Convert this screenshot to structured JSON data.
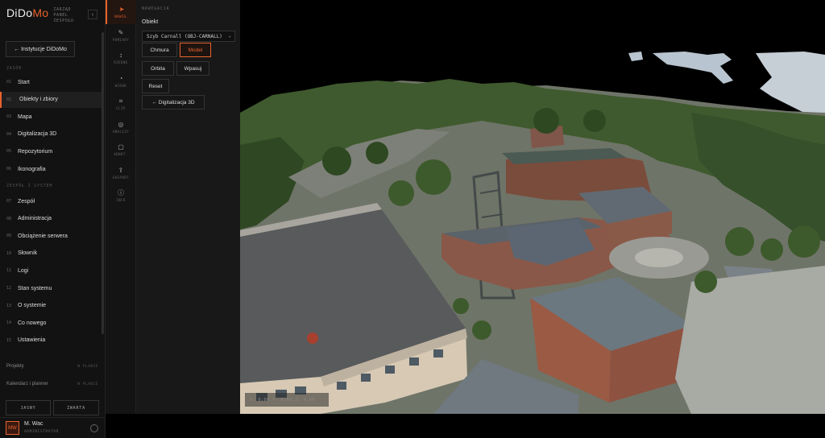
{
  "brand": {
    "logo_main": "DiDo",
    "logo_accent": "Mo",
    "subtitle_lines": [
      "ZARZĄD",
      "PANEL",
      "ZESPOŁU"
    ],
    "collapse_icon": "‹",
    "accent": "#e8622d"
  },
  "sidebar": {
    "institution_button": "← Instytucje DiDoMo",
    "section_zasob": "ZASÓB",
    "section_zespol": "ZESPÓŁ I SYSTEM",
    "items": [
      {
        "num": "01",
        "label": "Start"
      },
      {
        "num": "02",
        "label": "Obiekty i zbiory"
      },
      {
        "num": "03",
        "label": "Mapa"
      },
      {
        "num": "04",
        "label": "Digitalizacja 3D"
      },
      {
        "num": "05",
        "label": "Repozytorium"
      },
      {
        "num": "06",
        "label": "Ikonografia"
      }
    ],
    "items_system": [
      {
        "num": "07",
        "label": "Zespół"
      },
      {
        "num": "08",
        "label": "Administracja"
      },
      {
        "num": "09",
        "label": "Obciążenie serwera"
      },
      {
        "num": "10",
        "label": "Słownik"
      },
      {
        "num": "11",
        "label": "Logi"
      },
      {
        "num": "12",
        "label": "Stan systemu"
      },
      {
        "num": "13",
        "label": "O systemie"
      },
      {
        "num": "14",
        "label": "Co nowego"
      },
      {
        "num": "15",
        "label": "Ustawienia"
      }
    ],
    "sub_items": [
      {
        "label": "Projekty",
        "tag": "W PLANIE"
      },
      {
        "label": "Kalendarz i planner",
        "tag": "W PLANIE"
      }
    ],
    "footer_buttons": {
      "light": "JASNY",
      "font": "ZWARTA"
    },
    "user": {
      "initials": "MW",
      "name": "M. Wac",
      "role": "ADMINISTRATOR"
    }
  },
  "tools": [
    {
      "icon": "➤",
      "label": "NAWIG."
    },
    {
      "icon": "✎",
      "label": "POMIARY"
    },
    {
      "icon": "↕",
      "label": "RZEDNE"
    },
    {
      "icon": "◔",
      "label": "WIDOK"
    },
    {
      "icon": "⌗",
      "label": "CLIP"
    },
    {
      "icon": "◎",
      "label": "ANALIZY"
    },
    {
      "icon": "▢",
      "label": "ADNOT."
    },
    {
      "icon": "⇪",
      "label": "EKSPORT"
    },
    {
      "icon": "ⓘ",
      "label": "INFO"
    }
  ],
  "panel": {
    "heading": "NAWIGACJA",
    "object_label": "Obiekt",
    "object_value": "Szyb Carnall (OBJ-CARNALL)",
    "buttons": {
      "cloud": "Chmura",
      "model": "Model",
      "orbit": "Orbita",
      "fit": "Wpasuj",
      "reset": "Reset",
      "back": "← Digitalizacja 3D"
    }
  },
  "viewport": {
    "coord_readout": "X: 0.00  Y: 0.00  Z: 0.00"
  }
}
